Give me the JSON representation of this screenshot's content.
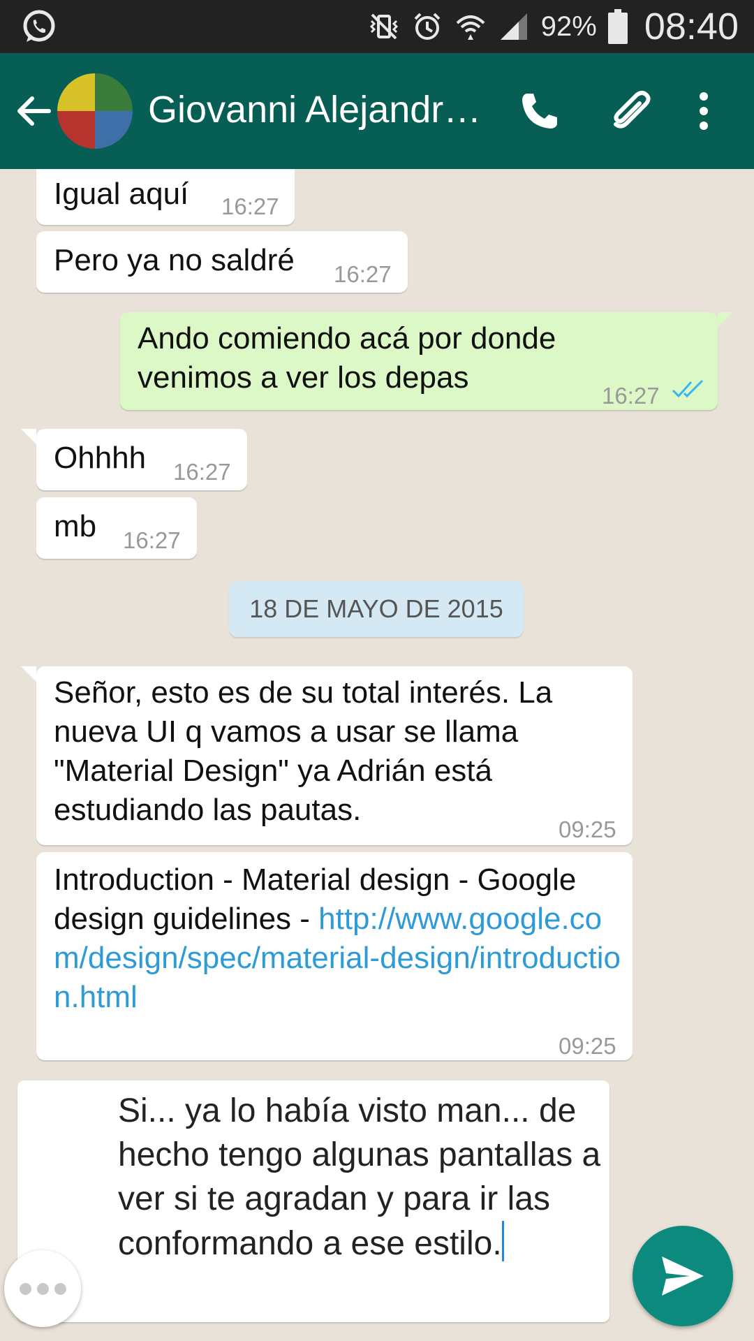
{
  "status_bar": {
    "battery_percent": "92%",
    "time": "08:40",
    "icons": [
      "whatsapp-icon",
      "vibrate-mute-icon",
      "alarm-icon",
      "wifi-icon",
      "signal-icon",
      "battery-icon"
    ]
  },
  "header": {
    "contact_name": "Giovanni Alejandro Ruiz",
    "icons": [
      "back-arrow-icon",
      "contact-avatar",
      "phone-icon",
      "attach-icon",
      "more-options-icon"
    ],
    "color": "#075e54"
  },
  "messages": [
    {
      "text": "Igual aquí",
      "time": "16:27",
      "direction": "in"
    },
    {
      "text": "Pero ya no saldré",
      "time": "16:27",
      "direction": "in"
    },
    {
      "text": "Ando comiendo acá por donde venimos a ver los depas",
      "time": "16:27",
      "direction": "out",
      "status": "read"
    },
    {
      "text": "Ohhhh",
      "time": "16:27",
      "direction": "in"
    },
    {
      "text": "mb",
      "time": "16:27",
      "direction": "in"
    },
    {
      "text": "Señor, esto es de su total interés. La nueva UI q vamos a usar se llama \"Material Design\" ya Adrián está estudiando las pautas.",
      "time": "09:25",
      "direction": "in"
    },
    {
      "text": "Introduction - Material design - Google design guidelines - ",
      "link": "http://www.google.com/design/spec/material-design/introduction.html",
      "time": "09:25",
      "direction": "in"
    }
  ],
  "date_divider": "18 DE MAYO DE 2015",
  "composer": {
    "draft_text": "Si... ya lo había visto man... de hecho tengo algunas pantallas a ver si te agradan y para ir las conformando a ese estilo."
  },
  "colors": {
    "incoming_bubble": "#ffffff",
    "outgoing_bubble": "#dcf8c6",
    "read_ticks": "#34b7f1",
    "send_button": "#0b8a7d"
  }
}
